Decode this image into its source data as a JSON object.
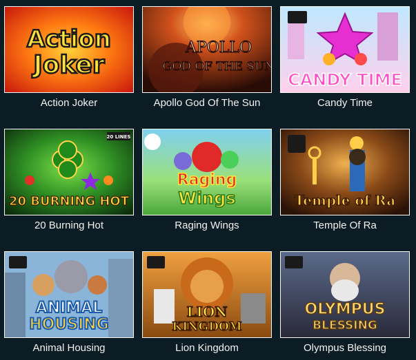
{
  "games": [
    {
      "name": "Action Joker",
      "logo": [
        "Action",
        "Joker"
      ]
    },
    {
      "name": "Apollo God Of The Sun",
      "logo": [
        "APOLLO",
        "GOD OF THE SUN"
      ]
    },
    {
      "name": "Candy Time",
      "logo": [
        "CANDY TIME"
      ]
    },
    {
      "name": "20 Burning Hot",
      "logo": [
        "20 BURNING HOT"
      ],
      "badge": "20 LINES"
    },
    {
      "name": "Raging Wings",
      "logo": [
        "Raging",
        "Wings"
      ]
    },
    {
      "name": "Temple Of Ra",
      "logo": [
        "Temple of Ra"
      ]
    },
    {
      "name": "Animal Housing",
      "logo": [
        "ANIMAL",
        "HOUSING"
      ]
    },
    {
      "name": "Lion Kingdom",
      "logo": [
        "LION",
        "KINGDOM"
      ]
    },
    {
      "name": "Olympus Blessing",
      "logo": [
        "OLYMPUS",
        "BLESSING"
      ]
    }
  ]
}
